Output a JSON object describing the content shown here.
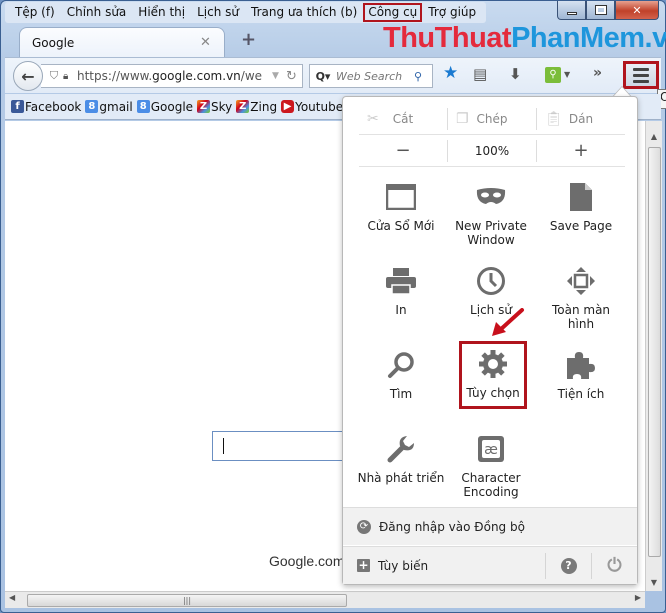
{
  "menubar": {
    "items": [
      "Tệp (f)",
      "Chỉnh sửa",
      "Hiển thị",
      "Lịch sử",
      "Trang ưa thích (b)",
      "Công cụ",
      "Trợ giúp"
    ],
    "highlighted": "Công cụ"
  },
  "window_controls": {
    "minimize": "minimize",
    "maximize": "maximize",
    "close": "✕"
  },
  "brand": {
    "part1": "ThuThuat",
    "part2": "PhanMem.vn"
  },
  "tabs": [
    {
      "title": "Google",
      "close": "✕"
    }
  ],
  "new_tab_label": "+",
  "navbar": {
    "back": "🡐",
    "url_prefix": "https://www.",
    "url_domain": "google.com.vn",
    "url_suffix": "/we",
    "search_placeholder": "Web Search",
    "overflow": "»"
  },
  "bookmarks": [
    {
      "icon": "facebook-icon",
      "glyph": "f",
      "label": "Facebook",
      "cls": "fb"
    },
    {
      "icon": "google-icon",
      "glyph": "8",
      "label": "gmail",
      "cls": "g8"
    },
    {
      "icon": "google-icon",
      "glyph": "8",
      "label": "Google",
      "cls": "g8"
    },
    {
      "icon": "zing-icon",
      "glyph": "Z",
      "label": "Sky",
      "cls": "zz"
    },
    {
      "icon": "zing-icon",
      "glyph": "Z",
      "label": "Zing",
      "cls": "zz"
    },
    {
      "icon": "youtube-icon",
      "glyph": "▶",
      "label": "Youtube",
      "cls": "yt"
    }
  ],
  "tooltip_partial": "O",
  "content": {
    "footer_text": "Google.com."
  },
  "panel": {
    "edit": {
      "cut": "Cắt",
      "copy": "Chép",
      "paste": "Dán"
    },
    "zoom": {
      "minus": "−",
      "level": "100%",
      "plus": "+"
    },
    "tiles": [
      {
        "id": "new-window",
        "label": "Cửa Sổ Mới"
      },
      {
        "id": "new-private-window",
        "label": "New Private Window"
      },
      {
        "id": "save-page",
        "label": "Save Page"
      },
      {
        "id": "print",
        "label": "In"
      },
      {
        "id": "history",
        "label": "Lịch sử"
      },
      {
        "id": "fullscreen",
        "label": "Toàn màn hình"
      },
      {
        "id": "find",
        "label": "Tìm"
      },
      {
        "id": "options",
        "label": "Tùy chọn"
      },
      {
        "id": "addons",
        "label": "Tiện ích"
      },
      {
        "id": "developer",
        "label": "Nhà phát triển"
      },
      {
        "id": "character-encoding",
        "label": "Character Encoding"
      }
    ],
    "sync_label": "Đăng nhập vào Đồng bộ",
    "customize_label": "Tùy biến",
    "help": "?",
    "highlight_color": "#b0141d"
  }
}
